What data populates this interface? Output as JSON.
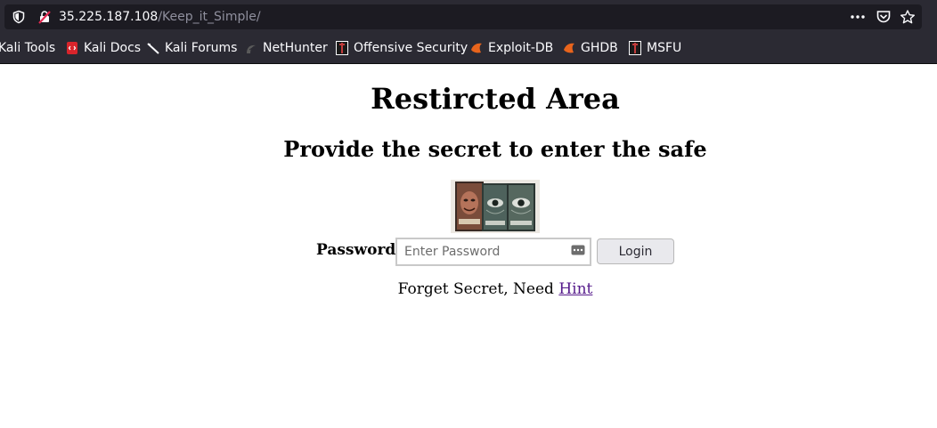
{
  "browser": {
    "url_host": "35.225.187.108",
    "url_path": "/Keep_it_Simple/",
    "bookmarks": [
      {
        "label": "Kali Tools",
        "icon": "kali-dragon-icon"
      },
      {
        "label": "Kali Docs",
        "icon": "kali-docs-icon"
      },
      {
        "label": "Kali Forums",
        "icon": "kali-forums-icon"
      },
      {
        "label": "NetHunter",
        "icon": "nethunter-icon"
      },
      {
        "label": "Offensive Security",
        "icon": "offsec-icon"
      },
      {
        "label": "Exploit-DB",
        "icon": "exploitdb-icon"
      },
      {
        "label": "GHDB",
        "icon": "ghdb-icon"
      },
      {
        "label": "MSFU",
        "icon": "msfu-icon"
      }
    ]
  },
  "page": {
    "title": "Restircted Area",
    "subtitle": "Provide the secret to enter the safe",
    "password_label": "Password",
    "password_placeholder": "Enter Password",
    "login_label": "Login",
    "hint_text": "Forget Secret, Need ",
    "hint_link": "Hint"
  },
  "colors": {
    "chrome_bg": "#2b2a33",
    "urlbar_bg": "#1c1b22",
    "visited_link": "#551a8b"
  }
}
